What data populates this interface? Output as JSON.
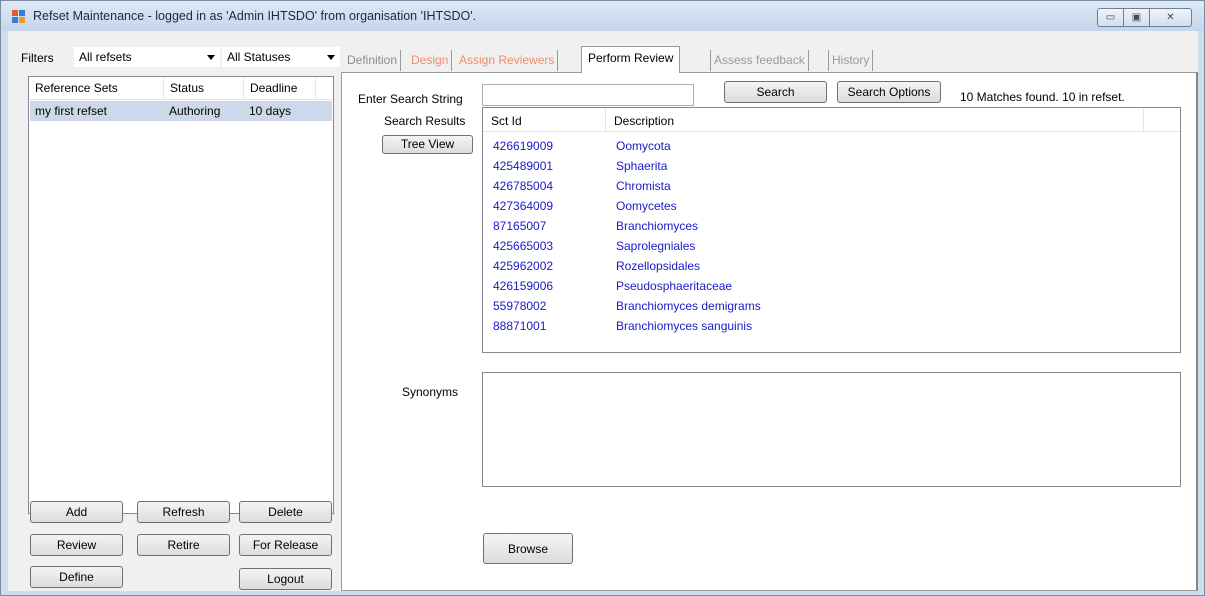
{
  "window": {
    "title": "Refset Maintenance - logged in as 'Admin IHTSDO' from organisation 'IHTSDO'.",
    "controls": {
      "minimize": "▭",
      "maximize": "▣",
      "close": "✕"
    }
  },
  "filters": {
    "label": "Filters",
    "refsets_value": "All refsets",
    "status_value": "All Statuses"
  },
  "refsets": {
    "columns": [
      "Reference Sets",
      "Status",
      "Deadline"
    ],
    "rows": [
      {
        "name": "my first refset",
        "status": "Authoring",
        "deadline": "10 days"
      }
    ]
  },
  "buttons": {
    "add": "Add",
    "refresh": "Refresh",
    "delete": "Delete",
    "review": "Review",
    "retire": "Retire",
    "for_release": "For Release",
    "define": "Define",
    "logout": "Logout"
  },
  "tabs": [
    {
      "label": "Definition",
      "color": "#8a8a8a"
    },
    {
      "label": "Design",
      "color": "#f08a6a"
    },
    {
      "label": "Assign Reviewers",
      "color": "#f08a6a"
    },
    {
      "label": "Perform Review",
      "color": "#000000",
      "active": true
    },
    {
      "label": "Assess feedback",
      "color": "#9a9a9a"
    },
    {
      "label": "History",
      "color": "#9a9a9a"
    }
  ],
  "review": {
    "search_label": "Enter Search String",
    "search_value": "",
    "search_button": "Search",
    "search_options_button": "Search Options",
    "match_text": "10 Matches found. 10 in refset.",
    "results_label": "Search Results",
    "tree_view_button": "Tree View",
    "columns": [
      "Sct Id",
      "Description"
    ],
    "results": [
      {
        "id": "426619009",
        "desc": "Oomycota"
      },
      {
        "id": "425489001",
        "desc": "Sphaerita"
      },
      {
        "id": "426785004",
        "desc": "Chromista"
      },
      {
        "id": "427364009",
        "desc": "Oomycetes"
      },
      {
        "id": "87165007",
        "desc": "Branchiomyces"
      },
      {
        "id": "425665003",
        "desc": "Saprolegniales"
      },
      {
        "id": "425962002",
        "desc": "Rozellopsidales"
      },
      {
        "id": "426159006",
        "desc": "Pseudosphaeritaceae"
      },
      {
        "id": "55978002",
        "desc": "Branchiomyces demigrams"
      },
      {
        "id": "88871001",
        "desc": "Branchiomyces sanguinis"
      }
    ],
    "synonyms_label": "Synonyms",
    "browse_button": "Browse",
    "link_color": "#1a1ac8"
  }
}
